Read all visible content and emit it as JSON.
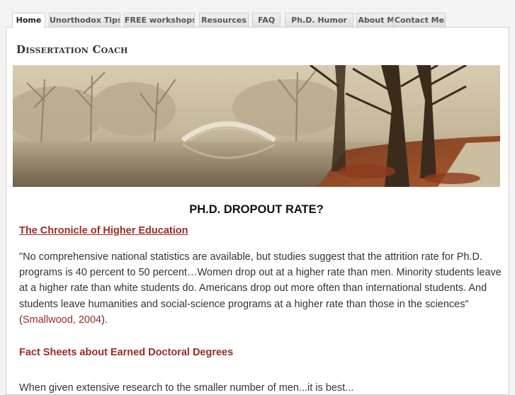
{
  "nav": {
    "tabs": [
      {
        "label": "Home",
        "active": true
      },
      {
        "label": "Unorthodox Tips",
        "active": false
      },
      {
        "label": "FREE workshops",
        "active": false
      },
      {
        "label": "Resources",
        "active": false
      },
      {
        "label": "FAQ",
        "active": false
      },
      {
        "label": "Ph.D. Humor",
        "active": false
      },
      {
        "label": "About Me",
        "active": false
      },
      {
        "label": "Contact Me",
        "active": false
      }
    ]
  },
  "header": {
    "site_title": "Dissertation Coach"
  },
  "banner": {
    "description": "misty lake with stone footbridge and trees"
  },
  "main": {
    "heading": "PH.D. DROPOUT RATE?",
    "source_link": "The Chronicle of Higher Education",
    "quote_text": "\"No comprehensive national statistics are available, but studies suggest that the attrition rate for Ph.D. programs is 40 percent to 50 percent…Women drop out at a higher rate than men. Minority students leave at a higher rate than white students do. Americans drop out more often than international students. And students leave humanities and social-science programs at a higher rate than those in the sciences\" (",
    "citation_link": "Smallwood, 2004",
    "quote_end": ").",
    "section_heading": "Fact Sheets about Earned Doctoral Degrees",
    "cutoff_text": "When given extensive research to the smaller number of men...it is best..."
  },
  "colors": {
    "link": "#9c2a22",
    "background": "#f3f3f3",
    "panel": "#ffffff"
  }
}
